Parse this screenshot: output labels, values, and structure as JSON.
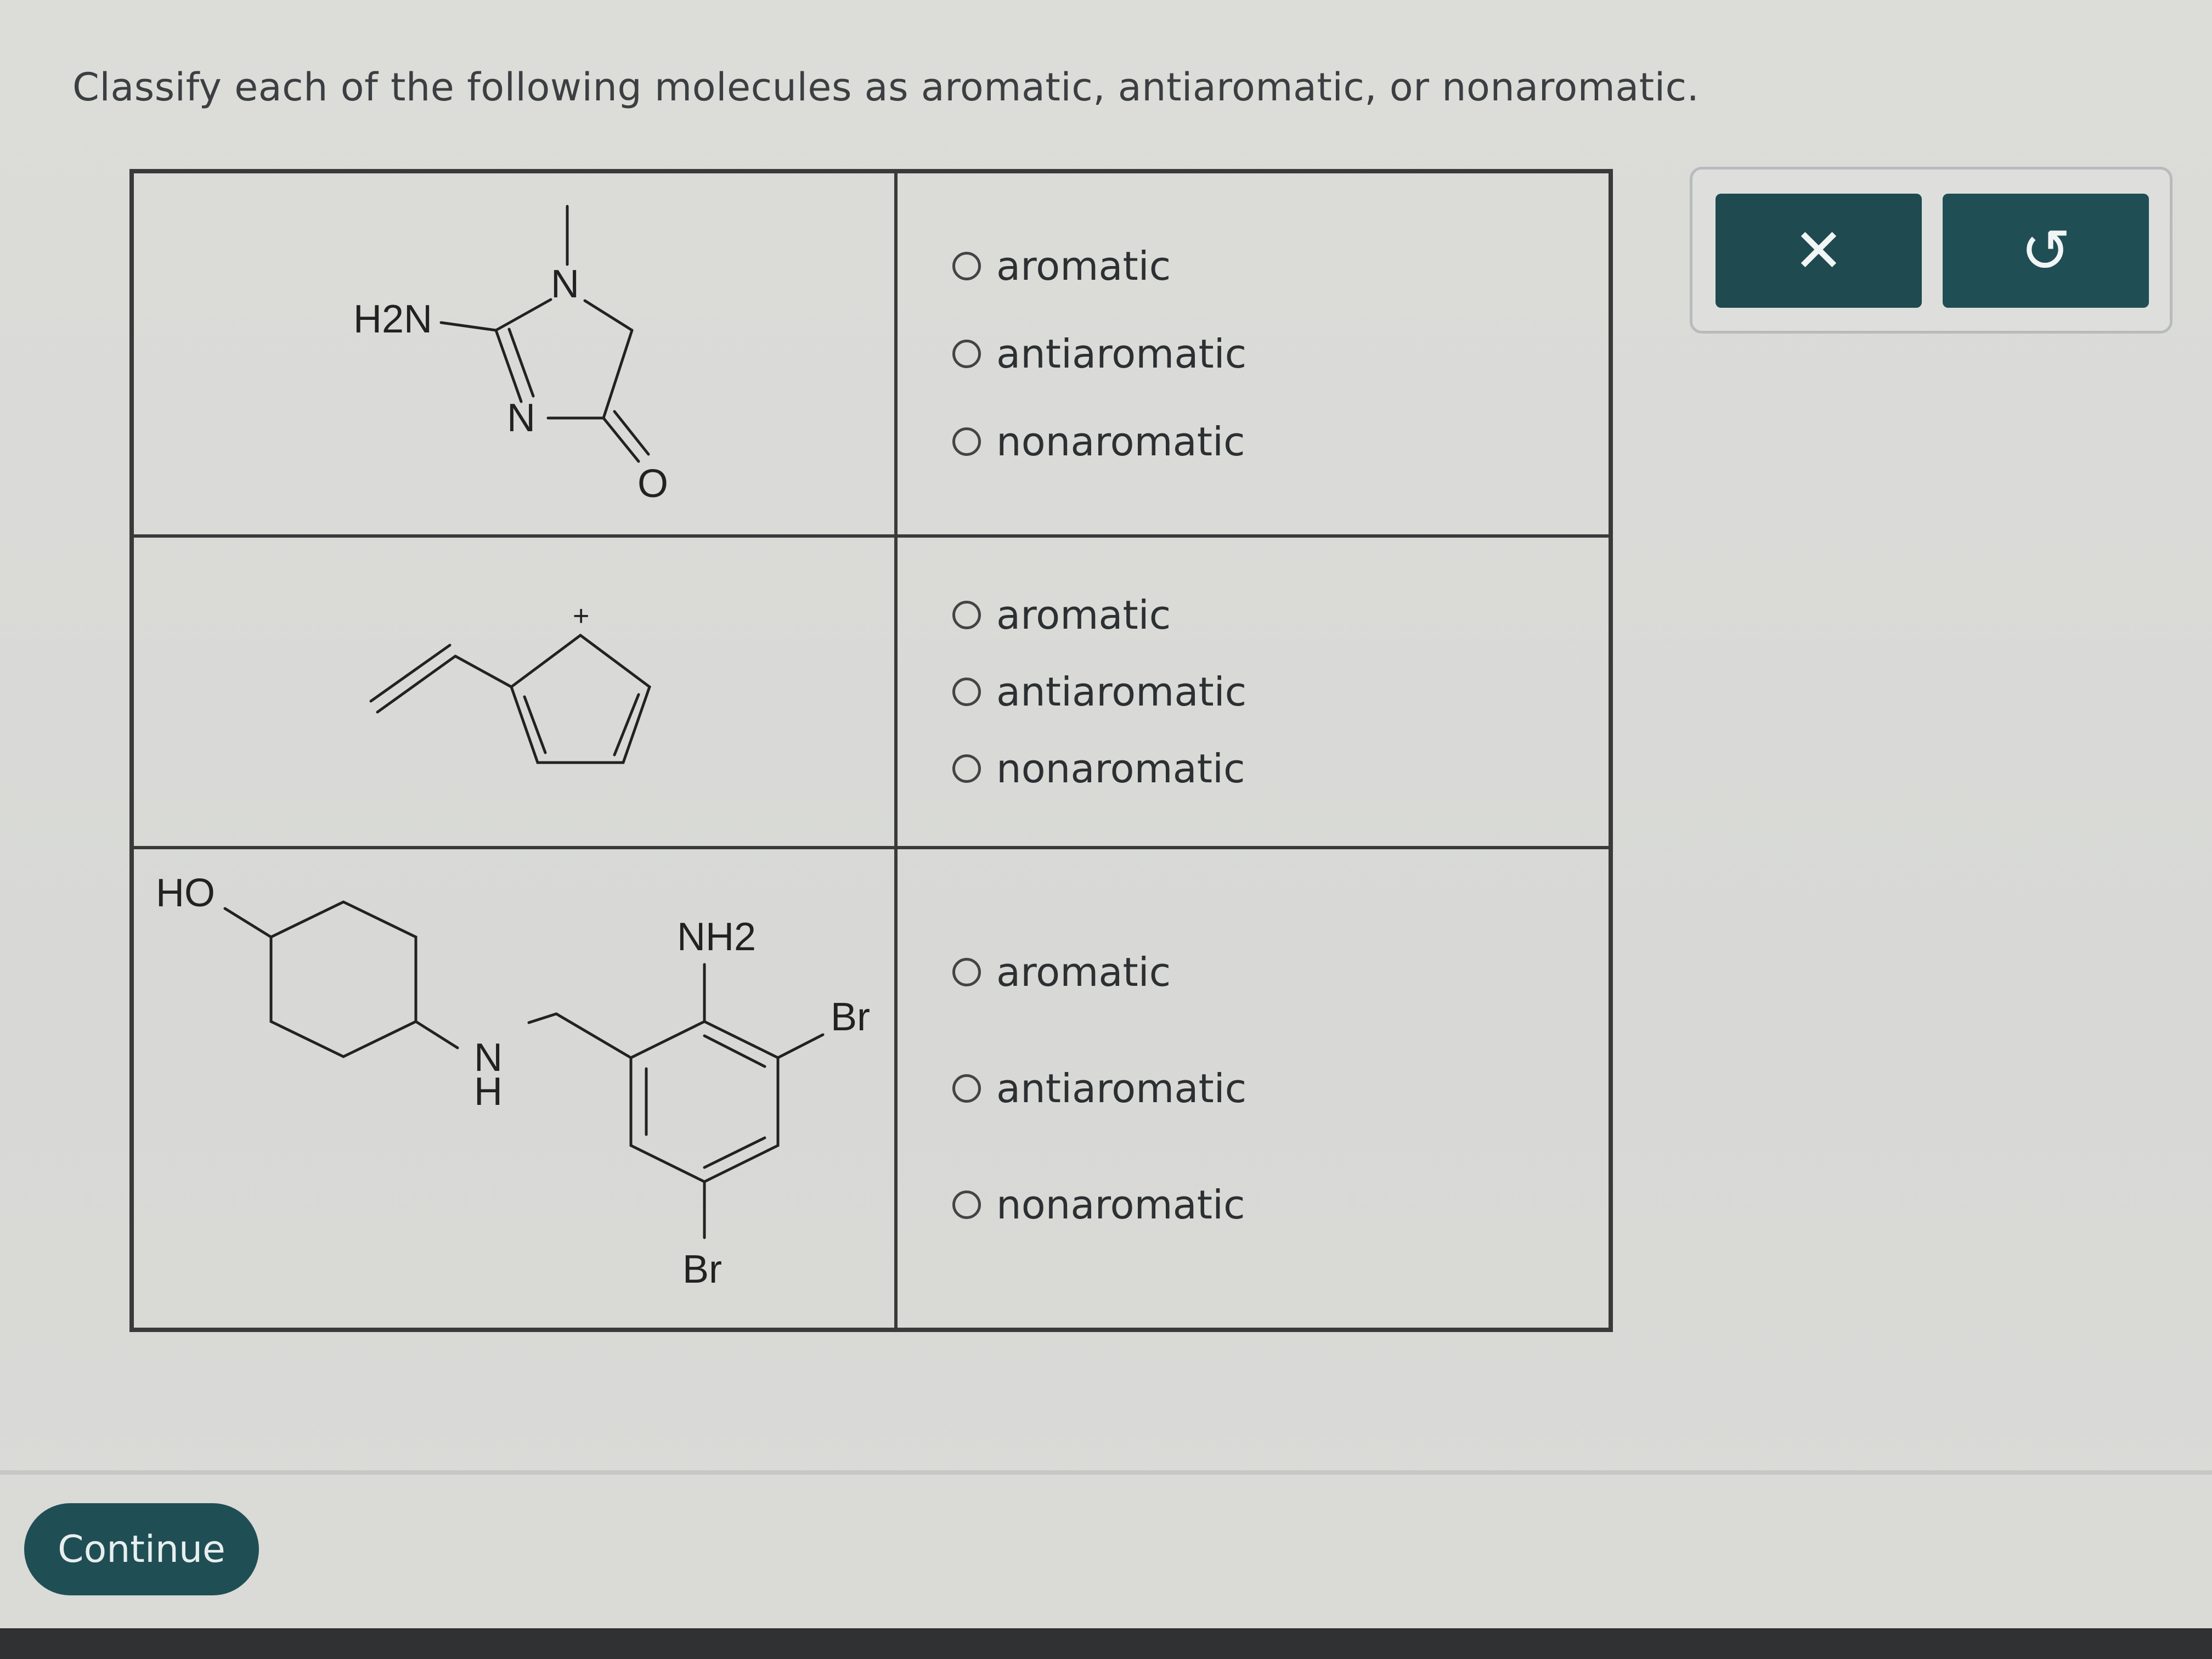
{
  "question": {
    "prompt": "Classify each of the following molecules as aromatic, antiaromatic, or nonaromatic."
  },
  "rows": [
    {
      "molecule": {
        "labels": {
          "amine": "H2N",
          "n_top": "N",
          "n_ring": "N",
          "oxygen": "O"
        }
      },
      "options": [
        "aromatic",
        "antiaromatic",
        "nonaromatic"
      ]
    },
    {
      "molecule": {
        "labels": {
          "charge": "+"
        }
      },
      "options": [
        "aromatic",
        "antiaromatic",
        "nonaromatic"
      ]
    },
    {
      "molecule": {
        "labels": {
          "hydroxyl": "HO",
          "amine": "NH2",
          "nh_n": "N",
          "nh_h": "H",
          "br_right": "Br",
          "br_bottom": "Br"
        }
      },
      "options": [
        "aromatic",
        "antiaromatic",
        "nonaromatic"
      ]
    }
  ],
  "tools": {
    "clear_glyph": "✕",
    "undo_glyph": "↺"
  },
  "footer": {
    "continue_label": "Continue"
  },
  "colors": {
    "accent": "#1f4f55",
    "background": "#d8d9d6",
    "line": "#3a3a3a"
  }
}
